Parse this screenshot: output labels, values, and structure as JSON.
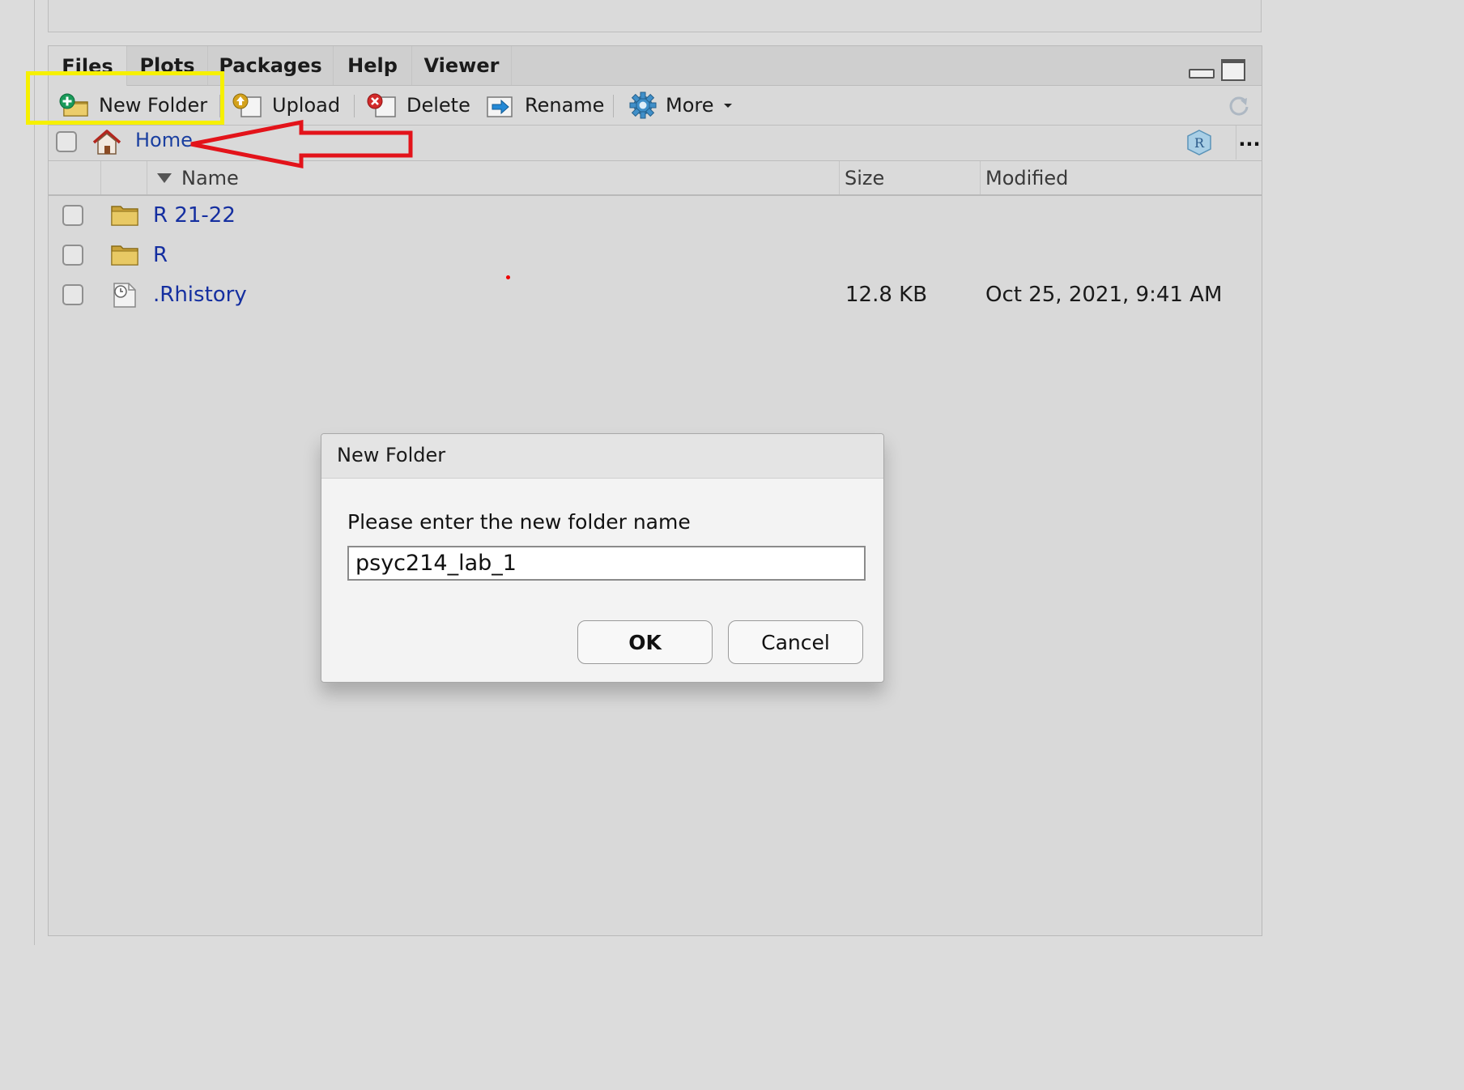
{
  "tabs": [
    {
      "label": "Files",
      "active": true
    },
    {
      "label": "Plots"
    },
    {
      "label": "Packages"
    },
    {
      "label": "Help"
    },
    {
      "label": "Viewer"
    }
  ],
  "toolbar": {
    "new_folder": "New Folder",
    "upload": "Upload",
    "delete": "Delete",
    "rename": "Rename",
    "more": "More"
  },
  "breadcrumb": {
    "home": "Home",
    "more": "..."
  },
  "columns": {
    "name": "Name",
    "size": "Size",
    "modified": "Modified"
  },
  "files": [
    {
      "name": "R 21-22",
      "type": "folder",
      "size": "",
      "modified": ""
    },
    {
      "name": "R",
      "type": "folder",
      "size": "",
      "modified": ""
    },
    {
      "name": ".Rhistory",
      "type": "file",
      "size": "12.8 KB",
      "modified": "Oct 25, 2021, 9:41 AM"
    }
  ],
  "dialog": {
    "title": "New Folder",
    "prompt": "Please enter the new folder name",
    "input_value": "psyc214_lab_1",
    "ok": "OK",
    "cancel": "Cancel"
  },
  "colors": {
    "annotation_highlight": "#f6f000",
    "annotation_arrow": "#e3131a",
    "link": "#152fa0"
  }
}
